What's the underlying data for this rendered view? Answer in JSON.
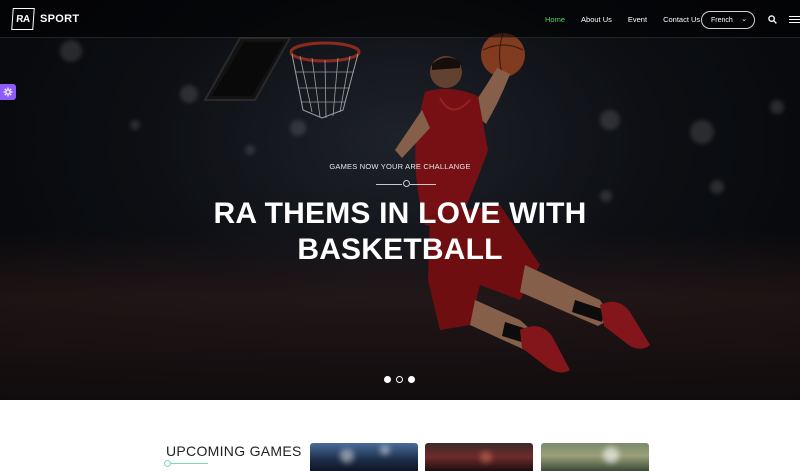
{
  "brand": {
    "mark": "RA",
    "name": "SPORT"
  },
  "nav": {
    "items": [
      {
        "label": "Home",
        "active": true
      },
      {
        "label": "About Us",
        "active": false
      },
      {
        "label": "Event",
        "active": false
      },
      {
        "label": "Contact Us",
        "active": false
      }
    ],
    "language": {
      "selected": "French"
    },
    "search_icon": "search-icon",
    "menu_icon": "hamburger-icon"
  },
  "side_widget": {
    "icon": "gear-icon",
    "color": "#8b5cf6"
  },
  "hero": {
    "subtitle": "GAMES NOW YOUR ARE CHALLANGE",
    "headline_line1": "RA THEMS IN LOVE WITH",
    "headline_line2": "BASKETBALL",
    "slides": {
      "count": 3,
      "active_index": 1
    }
  },
  "upcoming": {
    "title": "UPCOMING GAMES",
    "cards": [
      {
        "theme": "stadium"
      },
      {
        "theme": "basketball"
      },
      {
        "theme": "football"
      }
    ]
  },
  "colors": {
    "accent": "#4cd964",
    "line_accent": "#7ddcb0",
    "text_dark": "#222222"
  }
}
